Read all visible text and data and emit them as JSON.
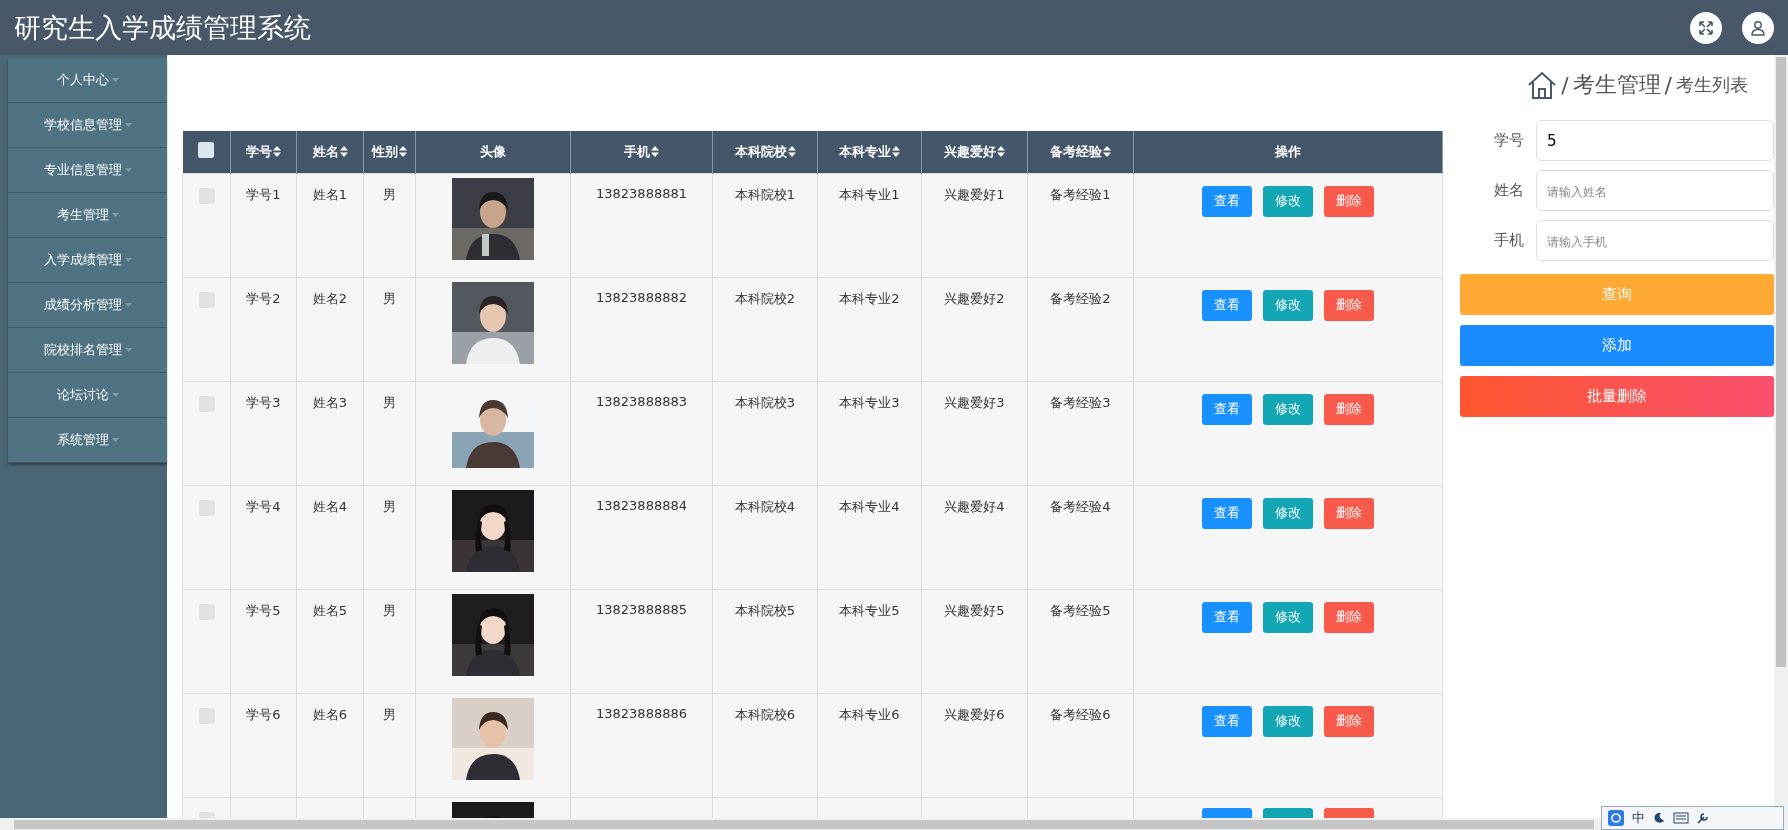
{
  "app_title": "研究生入学成绩管理系统",
  "sidebar": {
    "items": [
      {
        "label": "个人中心"
      },
      {
        "label": "学校信息管理"
      },
      {
        "label": "专业信息管理"
      },
      {
        "label": "考生管理"
      },
      {
        "label": "入学成绩管理"
      },
      {
        "label": "成绩分析管理"
      },
      {
        "label": "院校排名管理"
      },
      {
        "label": "论坛讨论"
      },
      {
        "label": "系统管理"
      }
    ]
  },
  "breadcrumb": {
    "separator_1": "/",
    "section": "考生管理",
    "separator_2": "/",
    "page": "考生列表"
  },
  "table": {
    "select_all_checked": false,
    "columns": [
      {
        "label": "学号",
        "sortable": true,
        "kind": "text"
      },
      {
        "label": "姓名",
        "sortable": true,
        "kind": "text"
      },
      {
        "label": "性别",
        "sortable": true,
        "kind": "text"
      },
      {
        "label": "头像",
        "sortable": false,
        "kind": "picture"
      },
      {
        "label": "手机",
        "sortable": true,
        "kind": "text"
      },
      {
        "label": "本科院校",
        "sortable": true,
        "kind": "text"
      },
      {
        "label": "本科专业",
        "sortable": true,
        "kind": "text"
      },
      {
        "label": "兴趣爱好",
        "sortable": true,
        "kind": "text"
      },
      {
        "label": "备考经验",
        "sortable": true,
        "kind": "text"
      },
      {
        "label": "操作",
        "sortable": false,
        "kind": "actions"
      }
    ],
    "rows": [
      {
        "checked": false,
        "cells": [
          "学号1",
          "姓名1",
          "男",
          "",
          "13823888881",
          "本科院校1",
          "本科专业1",
          "兴趣爱好1",
          "备考经验1"
        ],
        "actions": [
          {
            "label": "查看",
            "kind": "view"
          },
          {
            "label": "修改",
            "kind": "edit"
          },
          {
            "label": "删除",
            "kind": "delete"
          }
        ]
      },
      {
        "checked": false,
        "cells": [
          "学号2",
          "姓名2",
          "男",
          "",
          "13823888882",
          "本科院校2",
          "本科专业2",
          "兴趣爱好2",
          "备考经验2"
        ],
        "actions": [
          {
            "label": "查看",
            "kind": "view"
          },
          {
            "label": "修改",
            "kind": "edit"
          },
          {
            "label": "删除",
            "kind": "delete"
          }
        ]
      },
      {
        "checked": false,
        "cells": [
          "学号3",
          "姓名3",
          "男",
          "",
          "13823888883",
          "本科院校3",
          "本科专业3",
          "兴趣爱好3",
          "备考经验3"
        ],
        "actions": [
          {
            "label": "查看",
            "kind": "view"
          },
          {
            "label": "修改",
            "kind": "edit"
          },
          {
            "label": "删除",
            "kind": "delete"
          }
        ]
      },
      {
        "checked": false,
        "cells": [
          "学号4",
          "姓名4",
          "男",
          "",
          "13823888884",
          "本科院校4",
          "本科专业4",
          "兴趣爱好4",
          "备考经验4"
        ],
        "actions": [
          {
            "label": "查看",
            "kind": "view"
          },
          {
            "label": "修改",
            "kind": "edit"
          },
          {
            "label": "删除",
            "kind": "delete"
          }
        ]
      },
      {
        "checked": false,
        "cells": [
          "学号5",
          "姓名5",
          "男",
          "",
          "13823888885",
          "本科院校5",
          "本科专业5",
          "兴趣爱好5",
          "备考经验5"
        ],
        "actions": [
          {
            "label": "查看",
            "kind": "view"
          },
          {
            "label": "修改",
            "kind": "edit"
          },
          {
            "label": "删除",
            "kind": "delete"
          }
        ]
      },
      {
        "checked": false,
        "cells": [
          "学号6",
          "姓名6",
          "男",
          "",
          "13823888886",
          "本科院校6",
          "本科专业6",
          "兴趣爱好6",
          "备考经验6"
        ],
        "actions": [
          {
            "label": "查看",
            "kind": "view"
          },
          {
            "label": "修改",
            "kind": "edit"
          },
          {
            "label": "删除",
            "kind": "delete"
          }
        ]
      }
    ],
    "cut_row": {
      "checked": false,
      "actions": [
        {
          "kind": "view"
        },
        {
          "kind": "edit"
        },
        {
          "kind": "delete"
        }
      ]
    }
  },
  "search": {
    "fields": [
      {
        "label": "学号",
        "value": "5"
      },
      {
        "label": "姓名",
        "placeholder": "请输入姓名"
      },
      {
        "label": "手机",
        "placeholder": "请输入手机"
      }
    ],
    "buttons": [
      {
        "label": "查询",
        "kind": "query"
      },
      {
        "label": "添加",
        "kind": "add"
      },
      {
        "label": "批量删除",
        "kind": "batch-delete"
      }
    ]
  },
  "ime_bar": {
    "label": "中"
  }
}
